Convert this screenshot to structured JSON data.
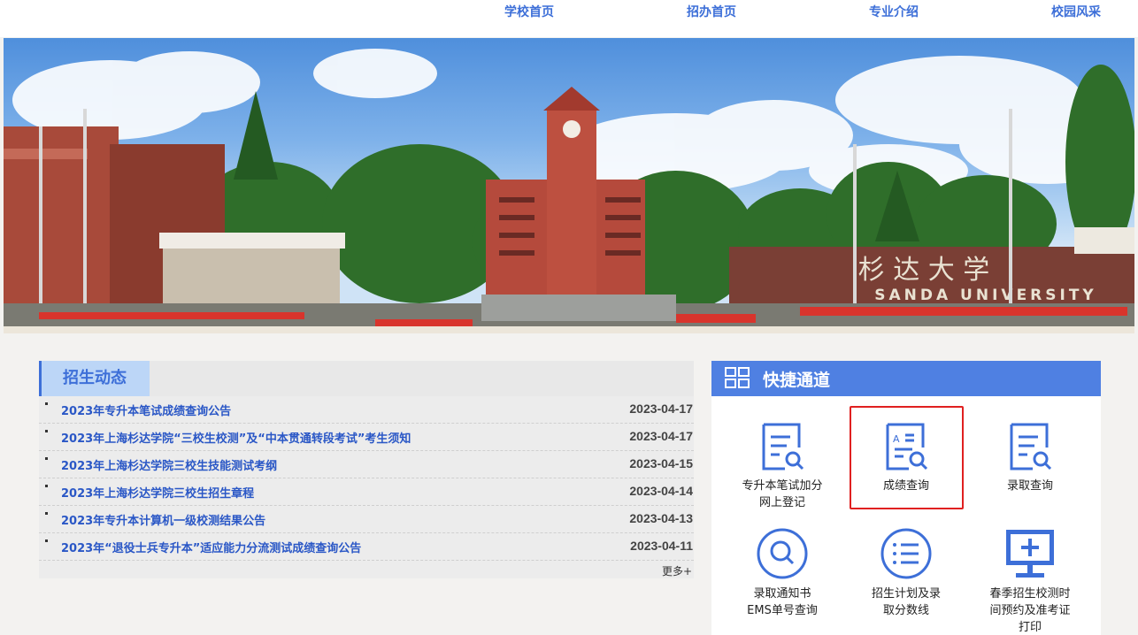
{
  "nav": {
    "items": [
      "学校首页",
      "招办首页",
      "专业介绍",
      "校园风采"
    ]
  },
  "banner": {
    "university_cn": "杉 达 大 学",
    "university_en": "SANDA UNIVERSITY"
  },
  "news": {
    "title": "招生动态",
    "items": [
      {
        "title": "2023年专升本笔试成绩查询公告",
        "date": "2023-04-17"
      },
      {
        "title": "2023年上海杉达学院“三校生校测”及“中本贯通转段考试”考生须知",
        "date": "2023-04-17"
      },
      {
        "title": "2023年上海杉达学院三校生技能测试考纲",
        "date": "2023-04-15"
      },
      {
        "title": "2023年上海杉达学院三校生招生章程",
        "date": "2023-04-14"
      },
      {
        "title": "2023年专升本计算机一级校测结果公告",
        "date": "2023-04-13"
      },
      {
        "title": "2023年“退役士兵专升本”适应能力分流测试成绩查询公告",
        "date": "2023-04-11"
      }
    ],
    "more": "更多+"
  },
  "quick": {
    "title": "快捷通道",
    "items": [
      {
        "label": "专升本笔试加分网上登记",
        "icon": "document-search-icon"
      },
      {
        "label": "成绩查询",
        "icon": "score-document-icon"
      },
      {
        "label": "录取查询",
        "icon": "document-search-icon"
      },
      {
        "label": "录取通知书EMS单号查询",
        "icon": "magnifier-circle-icon"
      },
      {
        "label": "招生计划及录取分数线",
        "icon": "list-circle-icon"
      },
      {
        "label": "春季招生校测时间预约及准考证打印",
        "icon": "monitor-plus-icon"
      }
    ],
    "accent": "#4f80e2",
    "highlight_color": "#e02020"
  }
}
